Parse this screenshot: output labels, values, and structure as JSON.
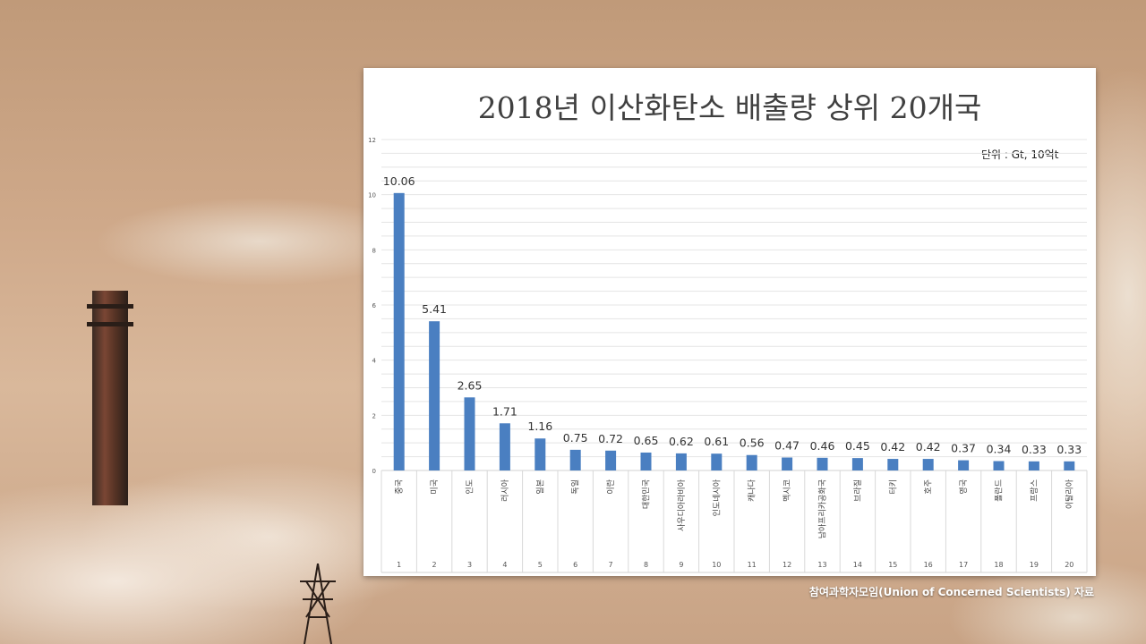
{
  "page": {
    "source_note": "참여과학자모임(Union of Concerned Scientists) 자료"
  },
  "chart_data": {
    "type": "bar",
    "title": "2018년 이산화탄소 배출량 상위 20개국",
    "unit_note": "단위 : Gt, 10억t",
    "ylim": [
      0,
      12
    ],
    "yticks": [
      "0",
      "2",
      "4",
      "6",
      "8",
      "10",
      "12"
    ],
    "grid": true,
    "bar_color": "#4a7fc1",
    "categories": [
      "중국",
      "미국",
      "인도",
      "러시아",
      "일본",
      "독일",
      "이란",
      "대한민국",
      "사우디아라비아",
      "인도네시아",
      "캐나다",
      "멕시코",
      "남아프리카공화국",
      "브라질",
      "터키",
      "호주",
      "영국",
      "폴란드",
      "프랑스",
      "이탈리아"
    ],
    "ranks": [
      "1",
      "2",
      "3",
      "4",
      "5",
      "6",
      "7",
      "8",
      "9",
      "10",
      "11",
      "12",
      "13",
      "14",
      "15",
      "16",
      "17",
      "18",
      "19",
      "20"
    ],
    "values": [
      10.06,
      5.41,
      2.65,
      1.71,
      1.16,
      0.75,
      0.72,
      0.65,
      0.62,
      0.61,
      0.56,
      0.47,
      0.46,
      0.45,
      0.42,
      0.42,
      0.37,
      0.34,
      0.33,
      0.33
    ],
    "value_labels": [
      "10.06",
      "5.41",
      "2.65",
      "1.71",
      "1.16",
      "0.75",
      "0.72",
      "0.65",
      "0.62",
      "0.61",
      "0.56",
      "0.47",
      "0.46",
      "0.45",
      "0.42",
      "0.42",
      "0.37",
      "0.34",
      "0.33",
      "0.33"
    ]
  }
}
